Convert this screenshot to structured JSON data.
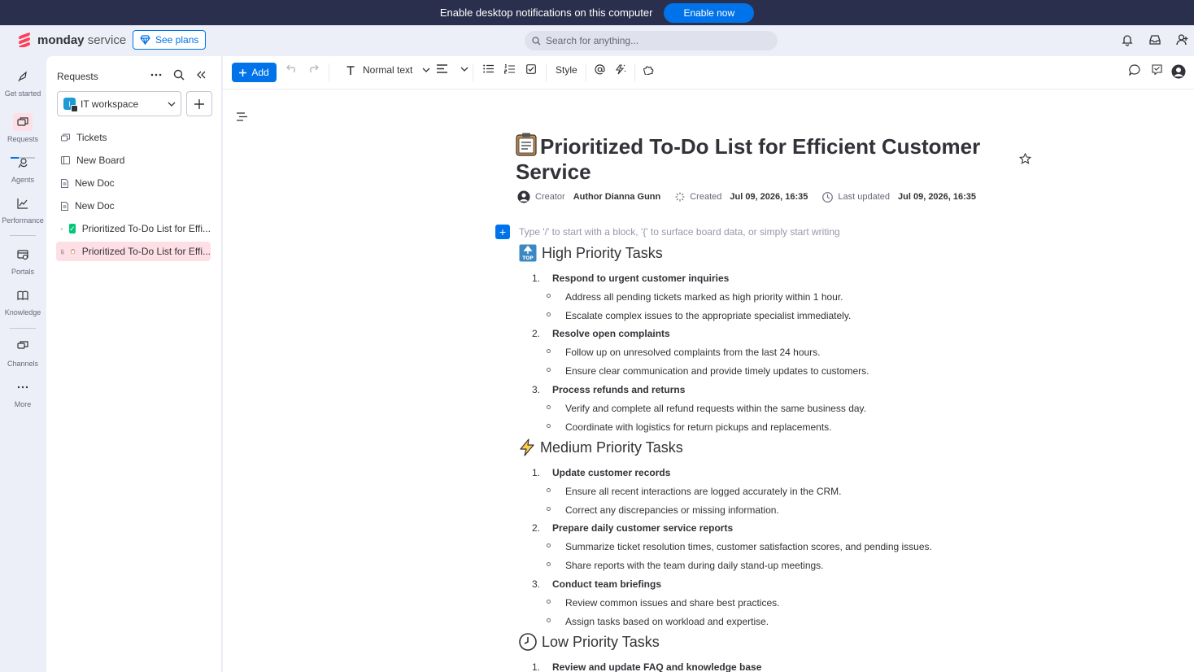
{
  "banner": {
    "message": "Enable desktop notifications on this computer",
    "button": "Enable now"
  },
  "header": {
    "brand": "monday",
    "brand_suffix": "service",
    "plans_button": "See plans",
    "search_placeholder": "Search for anything..."
  },
  "rail": {
    "items": [
      {
        "label": "Get started",
        "icon": "rocket-icon"
      },
      {
        "label": "Requests",
        "icon": "requests-icon",
        "active": true
      },
      {
        "label": "Agents",
        "icon": "agents-icon"
      },
      {
        "label": "Performance",
        "icon": "chart-icon"
      },
      {
        "label": "Portals",
        "icon": "portal-icon"
      },
      {
        "label": "Knowledge",
        "icon": "book-icon"
      },
      {
        "label": "Channels",
        "icon": "channels-icon"
      },
      {
        "label": "More",
        "icon": "more-icon"
      }
    ]
  },
  "panel": {
    "title": "Requests",
    "workspace": "IT workspace",
    "workspace_initial": "I",
    "items": [
      {
        "label": "Tickets",
        "icon": "tickets-icon"
      },
      {
        "label": "New Board",
        "icon": "board-icon"
      },
      {
        "label": "New Doc",
        "icon": "doc-icon"
      },
      {
        "label": "New Doc",
        "icon": "doc-icon"
      },
      {
        "label": "Prioritized To-Do List for Effi...",
        "icon": "doc-icon",
        "emoji": "check-emoji"
      },
      {
        "label": "Prioritized To-Do List for Effi...",
        "icon": "doc-icon",
        "emoji": "clipboard-emoji",
        "active": true
      }
    ]
  },
  "toolbar": {
    "add": "Add",
    "text_style": "Normal text",
    "style": "Style"
  },
  "doc": {
    "title": "Prioritized To-Do List for Efficient Customer Service",
    "creator_label": "Creator",
    "creator": "Author Dianna Gunn",
    "created_label": "Created",
    "created": "Jul 09, 2026, 16:35",
    "updated_label": "Last updated",
    "updated": "Jul 09, 2026, 16:35",
    "placeholder": "Type '/' to start with a block, '{' to surface board data, or simply start writing",
    "sections": [
      {
        "heading": "High Priority Tasks",
        "emoji": "top-emoji",
        "tasks": [
          {
            "num": "1.",
            "title": "Respond to urgent customer inquiries",
            "subs": [
              "Address all pending tickets marked as high priority within 1 hour.",
              "Escalate complex issues to the appropriate specialist immediately."
            ]
          },
          {
            "num": "2.",
            "title": "Resolve open complaints",
            "subs": [
              "Follow up on unresolved complaints from the last 24 hours.",
              "Ensure clear communication and provide timely updates to customers."
            ]
          },
          {
            "num": "3.",
            "title": "Process refunds and returns",
            "subs": [
              "Verify and complete all refund requests within the same business day.",
              "Coordinate with logistics for return pickups and replacements."
            ]
          }
        ]
      },
      {
        "heading": "Medium Priority Tasks",
        "emoji": "lightning-emoji",
        "tasks": [
          {
            "num": "1.",
            "title": "Update customer records",
            "subs": [
              "Ensure all recent interactions are logged accurately in the CRM.",
              "Correct any discrepancies or missing information."
            ]
          },
          {
            "num": "2.",
            "title": "Prepare daily customer service reports",
            "subs": [
              "Summarize ticket resolution times, customer satisfaction scores, and pending issues.",
              "Share reports with the team during daily stand-up meetings."
            ]
          },
          {
            "num": "3.",
            "title": "Conduct team briefings",
            "subs": [
              "Review common issues and share best practices.",
              "Assign tasks based on workload and expertise."
            ]
          }
        ]
      },
      {
        "heading": "Low Priority Tasks",
        "emoji": "clock-emoji",
        "tasks": [
          {
            "num": "1.",
            "title": "Review and update FAQ and knowledge base",
            "subs": []
          }
        ]
      }
    ]
  }
}
